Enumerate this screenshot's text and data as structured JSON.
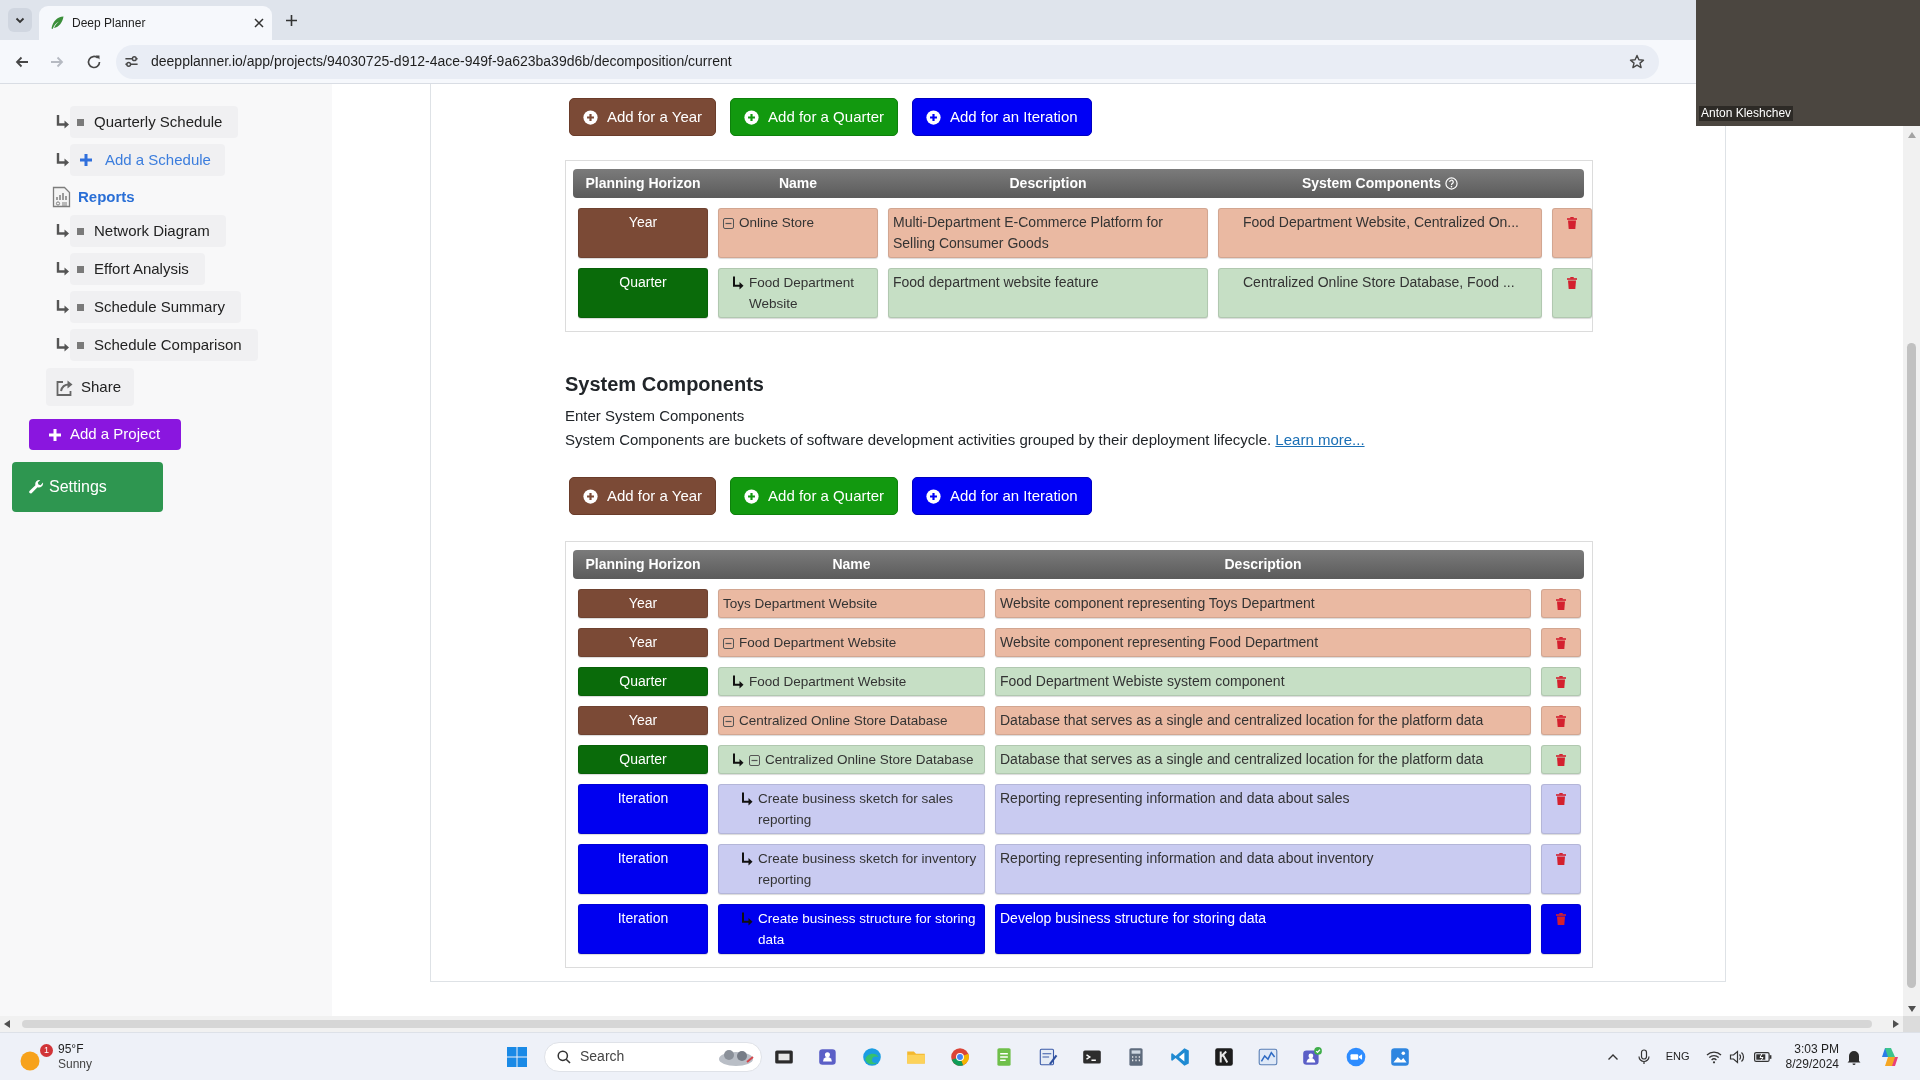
{
  "browser": {
    "tab_title": "Deep Planner",
    "url": "deepplanner.io/app/projects/94030725-d912-4ace-949f-9a623ba39d6b/decomposition/current",
    "forward_disabled": true
  },
  "video_call": {
    "participant_name": "Anton Kleshchev"
  },
  "sidebar": {
    "schedules": [
      "Quarterly Schedule"
    ],
    "add_schedule": "Add a Schedule",
    "reports": {
      "title": "Reports",
      "items": [
        "Network Diagram",
        "Effort Analysis",
        "Schedule Summary",
        "Schedule Comparison"
      ]
    },
    "share": "Share",
    "add_project": "Add a Project",
    "settings": "Settings"
  },
  "top_section": {
    "buttons": [
      {
        "label": "Add for a Year",
        "kind": "year"
      },
      {
        "label": "Add for a Quarter",
        "kind": "quarter"
      },
      {
        "label": "Add for an Iteration",
        "kind": "iteration"
      }
    ],
    "table": {
      "columns": [
        {
          "label": "Planning Horizon",
          "help": false
        },
        {
          "label": "Name",
          "help": false
        },
        {
          "label": "Description",
          "help": false
        },
        {
          "label": "System Components",
          "help": true
        }
      ],
      "rows": [
        {
          "kind": "year",
          "horizon": "Year",
          "name": "Online Store",
          "description": "Multi-Department E-Commerce Platform for Selling Consumer Goods",
          "components": "Food Department Website, Centralized On...",
          "selected": false,
          "expanded": true,
          "children": [
            {
              "kind": "quarter",
              "horizon": "Quarter",
              "name": "Food Department Website",
              "description": "Food department website feature",
              "components": "Centralized Online Store Database, Food ...",
              "selected": false
            }
          ]
        }
      ]
    }
  },
  "system_components": {
    "title": "System Components",
    "subtitle": "Enter System Components",
    "description": "System Components are buckets of software development activities grouped by their deployment lifecycle.",
    "link": "Learn more...",
    "buttons": [
      {
        "label": "Add for a Year",
        "kind": "year"
      },
      {
        "label": "Add for a Quarter",
        "kind": "quarter"
      },
      {
        "label": "Add for an Iteration",
        "kind": "iteration"
      }
    ],
    "table": {
      "columns": [
        {
          "label": "Planning Horizon",
          "help": false
        },
        {
          "label": "Name",
          "help": false
        },
        {
          "label": "Description",
          "help": false
        }
      ],
      "rows": [
        {
          "kind": "year",
          "horizon": "Year",
          "name": "Toys Department Website",
          "description": "Website component representing Toys Department",
          "selected": false
        },
        {
          "kind": "year",
          "horizon": "Year",
          "name": "Food Department Website",
          "description": "Website component representing Food Department",
          "selected": false,
          "expanded": true,
          "children": [
            {
              "kind": "quarter",
              "horizon": "Quarter",
              "name": "Food Department Website",
              "description": "Food Department Webiste system component",
              "selected": false
            }
          ]
        },
        {
          "kind": "year",
          "horizon": "Year",
          "name": "Centralized Online Store Database",
          "description": "Database that serves as a single and centralized location for the platform data",
          "selected": false,
          "expanded": true,
          "children": [
            {
              "kind": "quarter",
              "horizon": "Quarter",
              "name": "Centralized Online Store Database",
              "description": "Database that serves as a single and centralized location for the platform data",
              "selected": false,
              "expanded": true,
              "children": [
                {
                  "kind": "iteration",
                  "horizon": "Iteration",
                  "name": "Create business sketch for sales reporting",
                  "description": "Reporting representing information and data about sales",
                  "selected": false
                },
                {
                  "kind": "iteration",
                  "horizon": "Iteration",
                  "name": "Create business sketch for inventory reporting",
                  "description": "Reporting representing information and data about inventory",
                  "selected": false
                },
                {
                  "kind": "iteration",
                  "horizon": "Iteration",
                  "name": "Create business structure for storing data",
                  "description": "Develop business structure for storing data",
                  "selected": true
                }
              ]
            }
          ]
        }
      ]
    }
  },
  "taskbar": {
    "weather": {
      "temperature": "95°F",
      "condition": "Sunny",
      "badge": "1"
    },
    "search": {
      "placeholder": "Search"
    },
    "language": "ENG",
    "time": "3:03 PM",
    "date": "8/29/2024"
  }
}
